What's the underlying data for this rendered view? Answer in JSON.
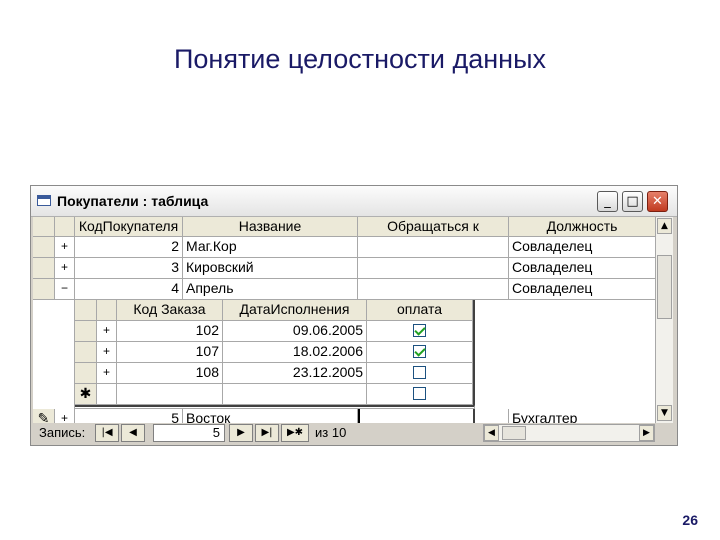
{
  "slide": {
    "title": "Понятие целостности данных",
    "page_number": "26"
  },
  "window": {
    "title": "Покупатели : таблица",
    "minimize": "_",
    "maximize": "□",
    "close": "✕"
  },
  "customers": {
    "columns": [
      "КодПокупателя",
      "Название",
      "Обращаться к",
      "Должность"
    ],
    "rows": [
      {
        "expander": "+",
        "id": "2",
        "name": "Маг.Кор",
        "contact": "",
        "position": "Совладелец"
      },
      {
        "expander": "+",
        "id": "3",
        "name": "Кировский",
        "contact": "",
        "position": "Совладелец"
      },
      {
        "expander": "−",
        "id": "4",
        "name": "Апрель",
        "contact": "",
        "position": "Совладелец"
      }
    ],
    "last_row": {
      "selector": "✎",
      "expander": "+",
      "id": "5",
      "name": "Восток",
      "contact": "",
      "position": "Бухгалтер"
    }
  },
  "orders": {
    "columns": [
      "Код Заказа",
      "ДатаИсполнения",
      "оплата"
    ],
    "rows": [
      {
        "expander": "+",
        "order_id": "102",
        "date": "09.06.2005",
        "paid": true
      },
      {
        "expander": "+",
        "order_id": "107",
        "date": "18.02.2006",
        "paid": true
      },
      {
        "expander": "+",
        "order_id": "108",
        "date": "23.12.2005",
        "paid": false
      }
    ],
    "new_row_marker": "✱"
  },
  "navigation": {
    "label": "Запись:",
    "current": "5",
    "of_label": "из",
    "total": "10",
    "first": "|◀",
    "prev": "◀",
    "next": "▶",
    "last": "▶|",
    "new": "▶✱"
  },
  "scroll": {
    "up": "▲",
    "down": "▼",
    "left": "◀",
    "right": "▶"
  }
}
